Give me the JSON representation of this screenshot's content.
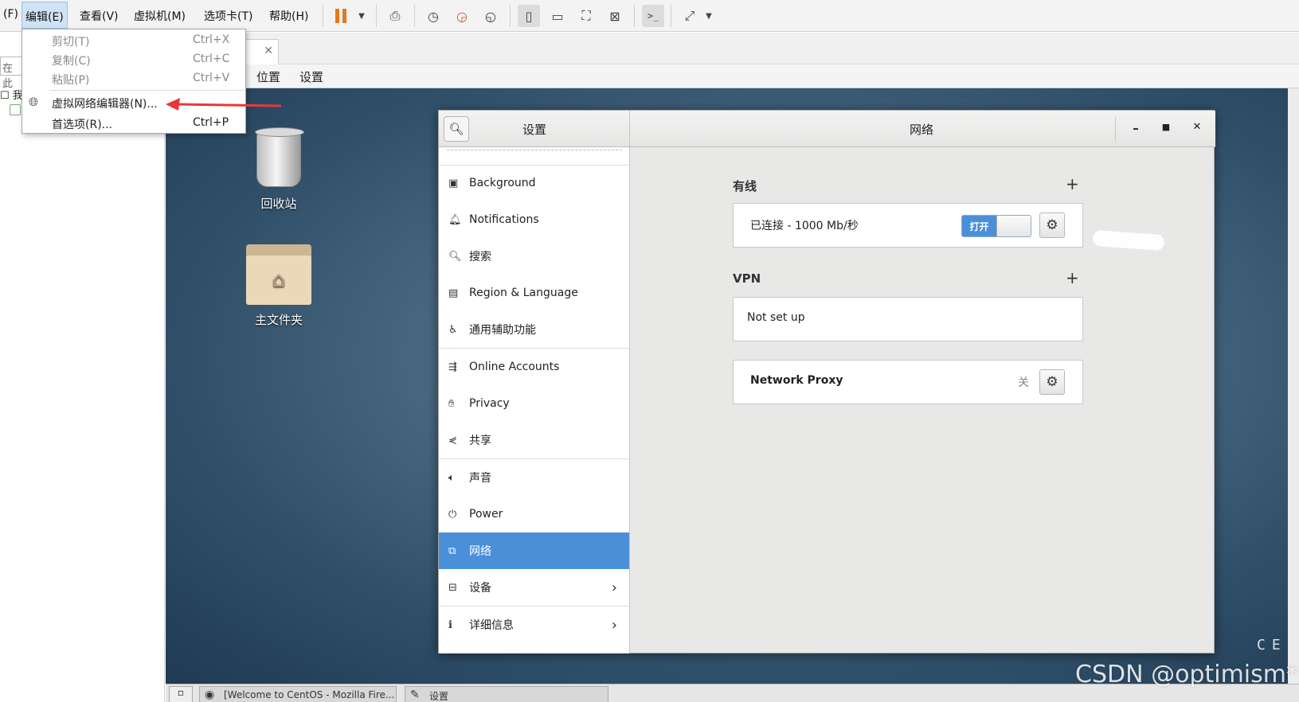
{
  "menubar": {
    "items": [
      "(F)",
      "编辑(E)",
      "查看(V)",
      "虚拟机(M)",
      "选项卡(T)",
      "帮助(H)"
    ]
  },
  "edit_menu": {
    "items": [
      {
        "label": "剪切(T)",
        "shortcut": "Ctrl+X",
        "enabled": false
      },
      {
        "label": "复制(C)",
        "shortcut": "Ctrl+C",
        "enabled": false
      },
      {
        "label": "粘贴(P)",
        "shortcut": "Ctrl+V",
        "enabled": false
      },
      {
        "label": "虚拟网络编辑器(N)...",
        "shortcut": "",
        "enabled": true,
        "icon": "network-globe-icon"
      },
      {
        "label": "首选项(R)...",
        "shortcut": "Ctrl+P",
        "enabled": true
      }
    ]
  },
  "library": {
    "search_placeholder": "在此",
    "tree_label": "我"
  },
  "gnome_topbar": {
    "items": [
      "位置",
      "设置"
    ]
  },
  "desktop": {
    "icons": [
      {
        "label": "回收站",
        "icon": "trash-icon"
      },
      {
        "label": "主文件夹",
        "icon": "home-folder-icon"
      }
    ],
    "corner_text": "CE"
  },
  "settings": {
    "left_title": "设置",
    "title": "网络",
    "sidebar": [
      {
        "label": "Background",
        "icon": "background-icon"
      },
      {
        "label": "Notifications",
        "icon": "bell-icon"
      },
      {
        "label": "搜索",
        "icon": "search-icon"
      },
      {
        "label": "Region & Language",
        "icon": "region-icon"
      },
      {
        "label": "通用辅助功能",
        "icon": "accessibility-icon"
      },
      {
        "label": "Online Accounts",
        "icon": "online-accounts-icon"
      },
      {
        "label": "Privacy",
        "icon": "privacy-hand-icon"
      },
      {
        "label": "共享",
        "icon": "share-icon"
      },
      {
        "label": "声音",
        "icon": "speaker-icon"
      },
      {
        "label": "Power",
        "icon": "power-icon"
      },
      {
        "label": "网络",
        "icon": "network-icon",
        "selected": true
      },
      {
        "label": "设备",
        "icon": "devices-icon",
        "chevron": true
      },
      {
        "label": "详细信息",
        "icon": "info-icon",
        "chevron": true
      }
    ],
    "wired": {
      "title": "有线",
      "status": "已连接 - 1000 Mb/秒",
      "toggle_label": "打开"
    },
    "vpn": {
      "title": "VPN",
      "status": "Not set up"
    },
    "proxy": {
      "label": "Network Proxy",
      "state": "关"
    }
  },
  "taskbar": {
    "tasks": [
      {
        "label": "[Welcome to CentOS - Mozilla Fire...",
        "icon": "firefox-icon"
      },
      {
        "label": "设置",
        "icon": "settings-tools-icon"
      }
    ]
  },
  "watermark": "CSDN @optimism*",
  "accent": "#4a90d9",
  "annotation_color": "#e8383a"
}
